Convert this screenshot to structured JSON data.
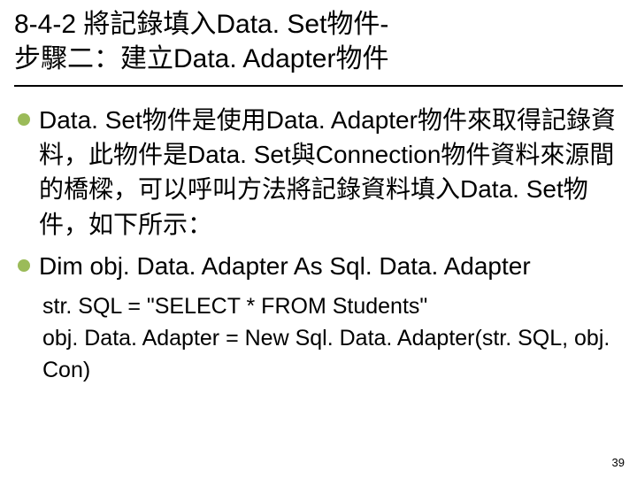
{
  "title": {
    "line1": "8-4-2 將記錄填入Data. Set物件-",
    "line2": "步驟二：建立Data. Adapter物件"
  },
  "bullets": [
    "Data. Set物件是使用Data. Adapter物件來取得記錄資料，此物件是Data. Set與Connection物件資料來源間的橋樑，可以呼叫方法將記錄資料填入Data. Set物件，如下所示：",
    "Dim obj. Data. Adapter As Sql. Data. Adapter"
  ],
  "code": {
    "line1": "str. SQL = \"SELECT * FROM Students\"",
    "line2": "obj. Data. Adapter = New Sql. Data. Adapter(str. SQL, obj. Con)"
  },
  "page_number": "39"
}
